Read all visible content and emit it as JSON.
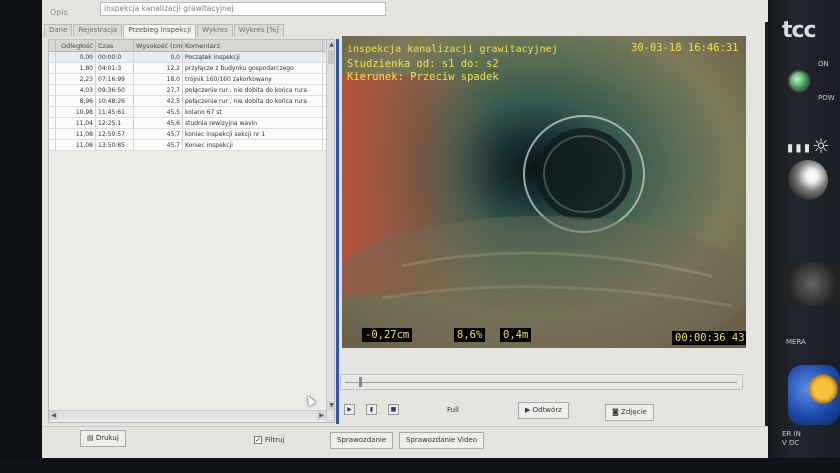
{
  "opis": {
    "label": "Opis",
    "value": "inspekcja kanalizacji grawitacyjnej"
  },
  "tabs": [
    {
      "label": "Dane",
      "active": false
    },
    {
      "label": "Rejestracja",
      "active": false
    },
    {
      "label": "Przebieg inspekcji",
      "active": true
    },
    {
      "label": "Wykres",
      "active": false
    },
    {
      "label": "Wykres [%]",
      "active": false
    }
  ],
  "table": {
    "columns": [
      "Odległość",
      "Czas",
      "Wysokość (cm)",
      "Komentarz"
    ],
    "rows": [
      {
        "distance": "0,00",
        "time": "00:00:0",
        "height": "0,0",
        "comment": "Początek inspekcji"
      },
      {
        "distance": "1,80",
        "time": "04:01:3",
        "height": "12,2",
        "comment": "przyłącze z budynku gospodarczego"
      },
      {
        "distance": "2,23",
        "time": "07:16:99",
        "height": "18,0",
        "comment": "trójnik 160/160 zakorkowany"
      },
      {
        "distance": "4,03",
        "time": "09:36:50",
        "height": "27,7",
        "comment": "połączenie rur , nie dobita do końca rura"
      },
      {
        "distance": "8,96",
        "time": "10:48:26",
        "height": "42,5",
        "comment": "połączenie rur , nie dobita do końca rura"
      },
      {
        "distance": "10,98",
        "time": "11:45:61",
        "height": "45,5",
        "comment": "kolano 67 st"
      },
      {
        "distance": "11,04",
        "time": "12:25:1",
        "height": "45,6",
        "comment": "studnia rewizyjna wavin"
      },
      {
        "distance": "11,08",
        "time": "12:59:57",
        "height": "45,7",
        "comment": "koniec inspekcji sekcji nr 1"
      },
      {
        "distance": "11,08",
        "time": "13:50:85",
        "height": "45,7",
        "comment": "Koniec inspekcji"
      }
    ]
  },
  "osd": {
    "title": "inspekcja kanalizacji grawitacyjnej",
    "datetime": "30-03-18 16:46:31",
    "manhole": "Studzienka od: s1 do: s2",
    "direction": "Kierunek: Przeciw spadek",
    "offset": "-0,27cm",
    "slope": "8,6%",
    "distance": "0,4m",
    "time": "00:00:36 43",
    "osd_color": "#f2e24a"
  },
  "controls": {
    "full_label": "Full",
    "play_label": "Odtwórz",
    "snapshot_label": "Zdjęcie"
  },
  "bottom": {
    "print_label": "Drukuj",
    "filter_label": "Filtruj",
    "filter_checked": true,
    "report_label": "Sprawozdanie",
    "video_report_label": "Sprawozdanie Video"
  },
  "device": {
    "logo": "tcc",
    "on_label": "ON",
    "power_label": "POW",
    "camera_label": "MERA",
    "power_in_label": "ER IN\nV DC"
  }
}
